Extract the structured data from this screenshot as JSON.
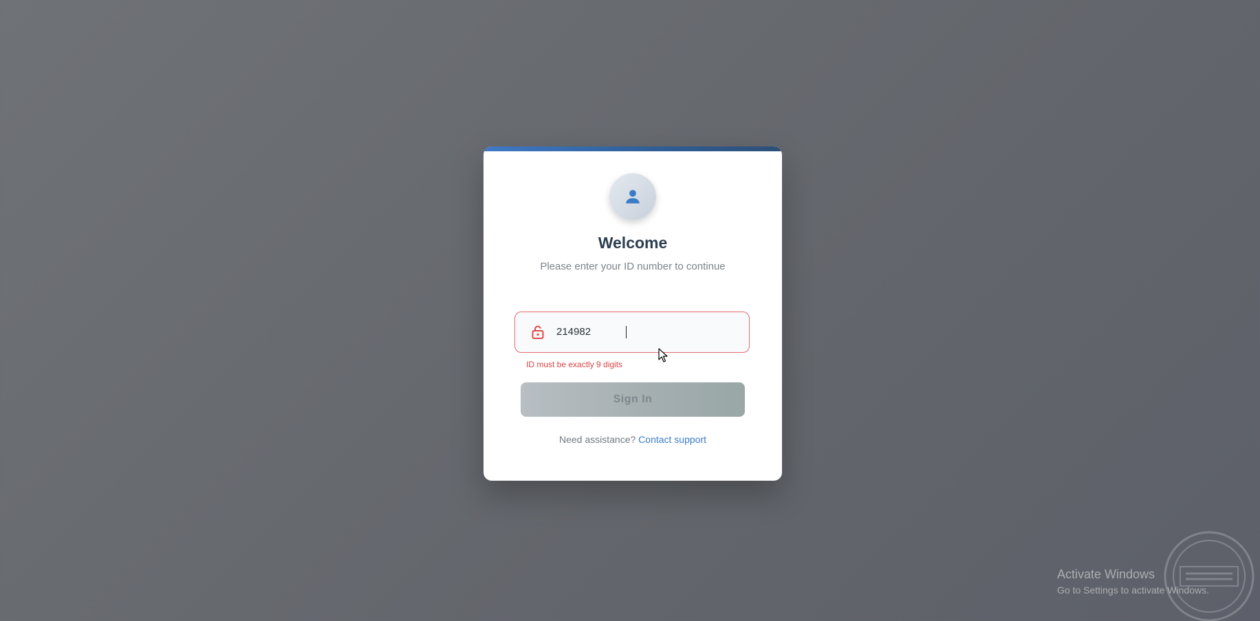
{
  "login": {
    "title": "Welcome",
    "subtitle": "Please enter your ID number to continue",
    "id_value": "214982",
    "error": "ID must be exactly 9 digits",
    "submit_label": "Sign In",
    "help_text": "Need assistance?",
    "help_link": "Contact support"
  },
  "os_watermark": {
    "title": "Activate Windows",
    "subtitle": "Go to Settings to activate Windows."
  },
  "icons": {
    "avatar": "user-icon",
    "field": "unlocked-padlock-icon",
    "pointer": "mouse-pointer-icon"
  },
  "colors": {
    "accent": "#3f79c7",
    "heading": "#2c3e50",
    "error": "#d64545",
    "link": "#3a7bc8",
    "button_disabled": "#a5afb1"
  }
}
